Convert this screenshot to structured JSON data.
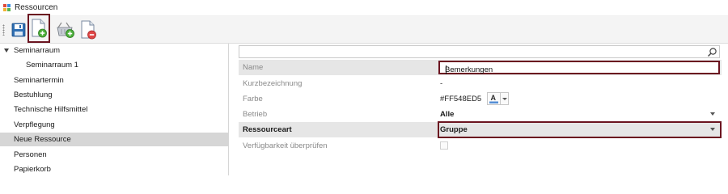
{
  "window": {
    "title": "Ressourcen"
  },
  "toolbar": {
    "buttons": [
      {
        "name": "save",
        "icon": "save-disk-icon"
      },
      {
        "name": "new-document",
        "icon": "new-document-add-icon",
        "highlighted": true
      },
      {
        "name": "add-basket",
        "icon": "basket-add-icon"
      },
      {
        "name": "delete-document",
        "icon": "document-remove-icon"
      }
    ]
  },
  "tree": {
    "items": [
      {
        "label": "Seminarraum",
        "expanded": true
      },
      {
        "label": "Seminarraum 1",
        "indent": true
      },
      {
        "label": "Seminartermin"
      },
      {
        "label": "Bestuhlung"
      },
      {
        "label": "Technische Hilfsmittel"
      },
      {
        "label": "Verpflegung"
      },
      {
        "label": "Neue Ressource",
        "selected": true
      },
      {
        "label": "Personen"
      },
      {
        "label": "Papierkorb"
      }
    ]
  },
  "search": {
    "placeholder": "",
    "icon": "search-icon"
  },
  "properties": {
    "name": {
      "label": "Name",
      "value": "Bemerkungen"
    },
    "kurzbezeichnung": {
      "label": "Kurzbezeichnung",
      "value": "-"
    },
    "farbe": {
      "label": "Farbe",
      "value": "#FF548ED5",
      "color_icon_glyph": "A",
      "accent_color": "#548ED5"
    },
    "betrieb": {
      "label": "Betrieb",
      "value": "Alle"
    },
    "ressourceart": {
      "label": "Ressourceart",
      "value": "Gruppe"
    },
    "verfuegbarkeit": {
      "label": "Verfügbarkeit überprüfen",
      "checked": false
    }
  },
  "colors": {
    "highlight_border": "#6b1420",
    "selection": "#d6d6d6"
  }
}
